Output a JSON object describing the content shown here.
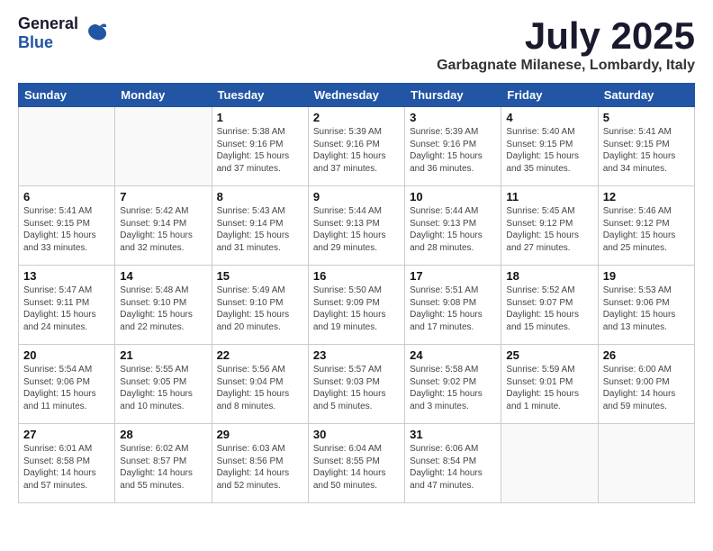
{
  "logo": {
    "general": "General",
    "blue": "Blue"
  },
  "title": "July 2025",
  "location": "Garbagnate Milanese, Lombardy, Italy",
  "weekdays": [
    "Sunday",
    "Monday",
    "Tuesday",
    "Wednesday",
    "Thursday",
    "Friday",
    "Saturday"
  ],
  "weeks": [
    [
      {
        "day": "",
        "sunrise": "",
        "sunset": "",
        "daylight": ""
      },
      {
        "day": "",
        "sunrise": "",
        "sunset": "",
        "daylight": ""
      },
      {
        "day": "1",
        "sunrise": "Sunrise: 5:38 AM",
        "sunset": "Sunset: 9:16 PM",
        "daylight": "Daylight: 15 hours and 37 minutes."
      },
      {
        "day": "2",
        "sunrise": "Sunrise: 5:39 AM",
        "sunset": "Sunset: 9:16 PM",
        "daylight": "Daylight: 15 hours and 37 minutes."
      },
      {
        "day": "3",
        "sunrise": "Sunrise: 5:39 AM",
        "sunset": "Sunset: 9:16 PM",
        "daylight": "Daylight: 15 hours and 36 minutes."
      },
      {
        "day": "4",
        "sunrise": "Sunrise: 5:40 AM",
        "sunset": "Sunset: 9:15 PM",
        "daylight": "Daylight: 15 hours and 35 minutes."
      },
      {
        "day": "5",
        "sunrise": "Sunrise: 5:41 AM",
        "sunset": "Sunset: 9:15 PM",
        "daylight": "Daylight: 15 hours and 34 minutes."
      }
    ],
    [
      {
        "day": "6",
        "sunrise": "Sunrise: 5:41 AM",
        "sunset": "Sunset: 9:15 PM",
        "daylight": "Daylight: 15 hours and 33 minutes."
      },
      {
        "day": "7",
        "sunrise": "Sunrise: 5:42 AM",
        "sunset": "Sunset: 9:14 PM",
        "daylight": "Daylight: 15 hours and 32 minutes."
      },
      {
        "day": "8",
        "sunrise": "Sunrise: 5:43 AM",
        "sunset": "Sunset: 9:14 PM",
        "daylight": "Daylight: 15 hours and 31 minutes."
      },
      {
        "day": "9",
        "sunrise": "Sunrise: 5:44 AM",
        "sunset": "Sunset: 9:13 PM",
        "daylight": "Daylight: 15 hours and 29 minutes."
      },
      {
        "day": "10",
        "sunrise": "Sunrise: 5:44 AM",
        "sunset": "Sunset: 9:13 PM",
        "daylight": "Daylight: 15 hours and 28 minutes."
      },
      {
        "day": "11",
        "sunrise": "Sunrise: 5:45 AM",
        "sunset": "Sunset: 9:12 PM",
        "daylight": "Daylight: 15 hours and 27 minutes."
      },
      {
        "day": "12",
        "sunrise": "Sunrise: 5:46 AM",
        "sunset": "Sunset: 9:12 PM",
        "daylight": "Daylight: 15 hours and 25 minutes."
      }
    ],
    [
      {
        "day": "13",
        "sunrise": "Sunrise: 5:47 AM",
        "sunset": "Sunset: 9:11 PM",
        "daylight": "Daylight: 15 hours and 24 minutes."
      },
      {
        "day": "14",
        "sunrise": "Sunrise: 5:48 AM",
        "sunset": "Sunset: 9:10 PM",
        "daylight": "Daylight: 15 hours and 22 minutes."
      },
      {
        "day": "15",
        "sunrise": "Sunrise: 5:49 AM",
        "sunset": "Sunset: 9:10 PM",
        "daylight": "Daylight: 15 hours and 20 minutes."
      },
      {
        "day": "16",
        "sunrise": "Sunrise: 5:50 AM",
        "sunset": "Sunset: 9:09 PM",
        "daylight": "Daylight: 15 hours and 19 minutes."
      },
      {
        "day": "17",
        "sunrise": "Sunrise: 5:51 AM",
        "sunset": "Sunset: 9:08 PM",
        "daylight": "Daylight: 15 hours and 17 minutes."
      },
      {
        "day": "18",
        "sunrise": "Sunrise: 5:52 AM",
        "sunset": "Sunset: 9:07 PM",
        "daylight": "Daylight: 15 hours and 15 minutes."
      },
      {
        "day": "19",
        "sunrise": "Sunrise: 5:53 AM",
        "sunset": "Sunset: 9:06 PM",
        "daylight": "Daylight: 15 hours and 13 minutes."
      }
    ],
    [
      {
        "day": "20",
        "sunrise": "Sunrise: 5:54 AM",
        "sunset": "Sunset: 9:06 PM",
        "daylight": "Daylight: 15 hours and 11 minutes."
      },
      {
        "day": "21",
        "sunrise": "Sunrise: 5:55 AM",
        "sunset": "Sunset: 9:05 PM",
        "daylight": "Daylight: 15 hours and 10 minutes."
      },
      {
        "day": "22",
        "sunrise": "Sunrise: 5:56 AM",
        "sunset": "Sunset: 9:04 PM",
        "daylight": "Daylight: 15 hours and 8 minutes."
      },
      {
        "day": "23",
        "sunrise": "Sunrise: 5:57 AM",
        "sunset": "Sunset: 9:03 PM",
        "daylight": "Daylight: 15 hours and 5 minutes."
      },
      {
        "day": "24",
        "sunrise": "Sunrise: 5:58 AM",
        "sunset": "Sunset: 9:02 PM",
        "daylight": "Daylight: 15 hours and 3 minutes."
      },
      {
        "day": "25",
        "sunrise": "Sunrise: 5:59 AM",
        "sunset": "Sunset: 9:01 PM",
        "daylight": "Daylight: 15 hours and 1 minute."
      },
      {
        "day": "26",
        "sunrise": "Sunrise: 6:00 AM",
        "sunset": "Sunset: 9:00 PM",
        "daylight": "Daylight: 14 hours and 59 minutes."
      }
    ],
    [
      {
        "day": "27",
        "sunrise": "Sunrise: 6:01 AM",
        "sunset": "Sunset: 8:58 PM",
        "daylight": "Daylight: 14 hours and 57 minutes."
      },
      {
        "day": "28",
        "sunrise": "Sunrise: 6:02 AM",
        "sunset": "Sunset: 8:57 PM",
        "daylight": "Daylight: 14 hours and 55 minutes."
      },
      {
        "day": "29",
        "sunrise": "Sunrise: 6:03 AM",
        "sunset": "Sunset: 8:56 PM",
        "daylight": "Daylight: 14 hours and 52 minutes."
      },
      {
        "day": "30",
        "sunrise": "Sunrise: 6:04 AM",
        "sunset": "Sunset: 8:55 PM",
        "daylight": "Daylight: 14 hours and 50 minutes."
      },
      {
        "day": "31",
        "sunrise": "Sunrise: 6:06 AM",
        "sunset": "Sunset: 8:54 PM",
        "daylight": "Daylight: 14 hours and 47 minutes."
      },
      {
        "day": "",
        "sunrise": "",
        "sunset": "",
        "daylight": ""
      },
      {
        "day": "",
        "sunrise": "",
        "sunset": "",
        "daylight": ""
      }
    ]
  ]
}
